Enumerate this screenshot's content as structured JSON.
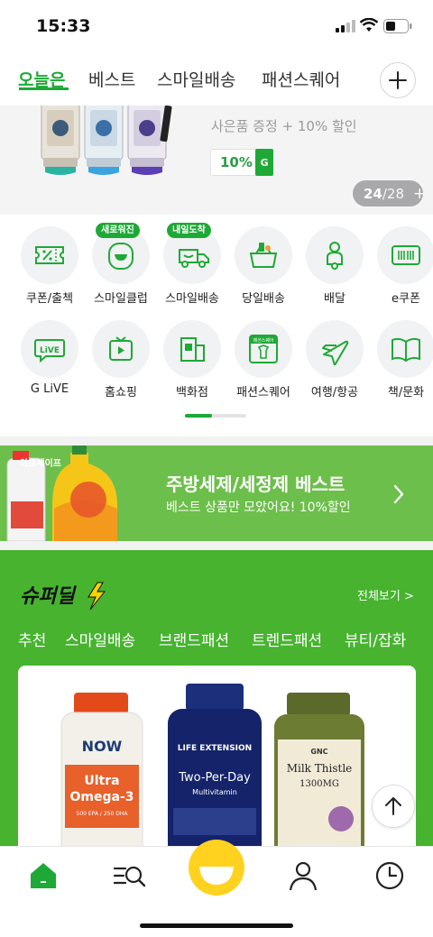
{
  "status_bar": {
    "time": "15:33"
  },
  "tabs": {
    "items": [
      "오늘은",
      "베스트",
      "스마일배송",
      "패션스퀘어"
    ],
    "active_index": 0
  },
  "banner": {
    "promo_text": "사은품 증정 + 10% 할인",
    "discount": "10%",
    "discount_badge": "G",
    "counter_current": "24",
    "counter_total": "/28",
    "counter_plus": "+"
  },
  "categories": [
    {
      "label": "쿠폰/출첵",
      "icon": "coupon-icon"
    },
    {
      "label": "스마일클럽",
      "icon": "smile-club-icon",
      "badge": "새로워진"
    },
    {
      "label": "스마일배송",
      "icon": "delivery-truck-icon",
      "badge": "내일도착"
    },
    {
      "label": "당일배송",
      "icon": "basket-icon"
    },
    {
      "label": "배달",
      "icon": "scooter-icon"
    },
    {
      "label": "e쿠폰",
      "icon": "barcode-icon"
    },
    {
      "label": "G LiVE",
      "icon": "live-bubble-icon"
    },
    {
      "label": "홈쇼핑",
      "icon": "tv-play-icon"
    },
    {
      "label": "백화점",
      "icon": "store-building-icon"
    },
    {
      "label": "패션스퀘어",
      "icon": "fashion-square-icon",
      "icon_text": "패션스퀘어"
    },
    {
      "label": "여행/항공",
      "icon": "airplane-icon"
    },
    {
      "label": "책/문화",
      "icon": "book-icon"
    }
  ],
  "ad": {
    "brand": "아토세이프",
    "title": "주방세제/세정제 베스트",
    "subtitle": "베스트 상품만 모았어요! 10%할인"
  },
  "super_deal": {
    "logo": "슈퍼딜",
    "see_all": "전체보기 >",
    "categories": [
      "추천",
      "스마일배송",
      "브랜드패션",
      "트렌드패션",
      "뷰티/잡화"
    ],
    "products": [
      {
        "brand": "NOW",
        "name": "Ultra Omega-3",
        "detail": "500 EPA / 250 DHA"
      },
      {
        "brand": "LIFE EXTENSION",
        "name": "Two-Per-Day",
        "detail": "Multivitamin"
      },
      {
        "brand": "GNC",
        "name": "Milk Thistle",
        "detail": "1300MG"
      }
    ]
  },
  "bottom_nav": [
    "home-icon",
    "category-search-icon",
    "smile-center-icon",
    "my-page-icon",
    "recent-history-icon"
  ],
  "colors": {
    "accent": "#1ea936",
    "deal_bg": "#47b32f",
    "ad_bg": "#6cbf4a"
  }
}
